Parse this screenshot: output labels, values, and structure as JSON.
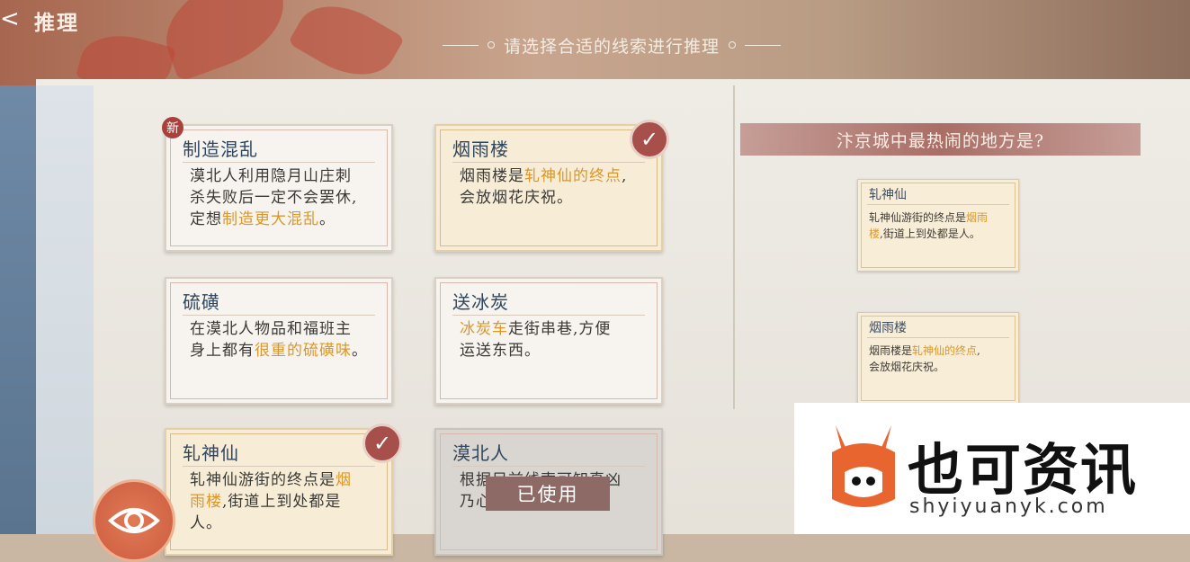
{
  "header": {
    "back_glyph": "<",
    "title": "推理",
    "subtitle": "请选择合适的线索进行推理"
  },
  "clues": [
    {
      "name": "制造混乱",
      "badge": "新",
      "lines": [
        [
          "漠北人利用隐月山庄刺"
        ],
        [
          "杀失败后一定不会罢休,"
        ],
        [
          "定想",
          "制造更大混乱",
          "。"
        ]
      ]
    },
    {
      "name": "烟雨楼",
      "checked": true,
      "lines": [
        [
          "烟雨楼是",
          "轧神仙的终点",
          ","
        ],
        [
          "会放烟花庆祝。"
        ]
      ]
    },
    {
      "name": "硫磺",
      "lines": [
        [
          "在漠北人物品和福班主"
        ],
        [
          "身上都有",
          "很重的硫磺味",
          "。"
        ]
      ]
    },
    {
      "name": "送冰炭",
      "lines": [
        [
          "",
          "冰炭车",
          "走街串巷,方便"
        ],
        [
          "运送东西。"
        ]
      ]
    },
    {
      "name": "轧神仙",
      "checked": true,
      "lines": [
        [
          "轧神仙游街的终点是",
          "烟"
        ],
        [
          "",
          "雨楼",
          ",街道上到处都是"
        ],
        [
          "人。"
        ]
      ]
    },
    {
      "name": "漠北人",
      "used": true,
      "lines": [
        [
          "根据目前线索可知真凶"
        ],
        [
          "乃心"
        ]
      ]
    }
  ],
  "used_label": "已使用",
  "question": "汴京城中最热闹的地方是?",
  "selected": [
    {
      "name": "轧神仙",
      "body_plain1": "轧神仙游街的终点是",
      "body_hl1": "烟雨",
      "body_hl2": "楼",
      "body_plain2": ",街道上到处都是人。"
    },
    {
      "name": "烟雨楼",
      "body_plain1": "烟雨楼是",
      "body_hl1": "轧神仙的终点",
      "body_plain2": ",",
      "body_plain3": "会放烟花庆祝。"
    }
  ],
  "watermark": {
    "cn": "也可资讯",
    "en": "shyiyuanyk.com"
  },
  "colors": {
    "accent_check": "#a74f4a",
    "highlight": "#d9972d"
  }
}
